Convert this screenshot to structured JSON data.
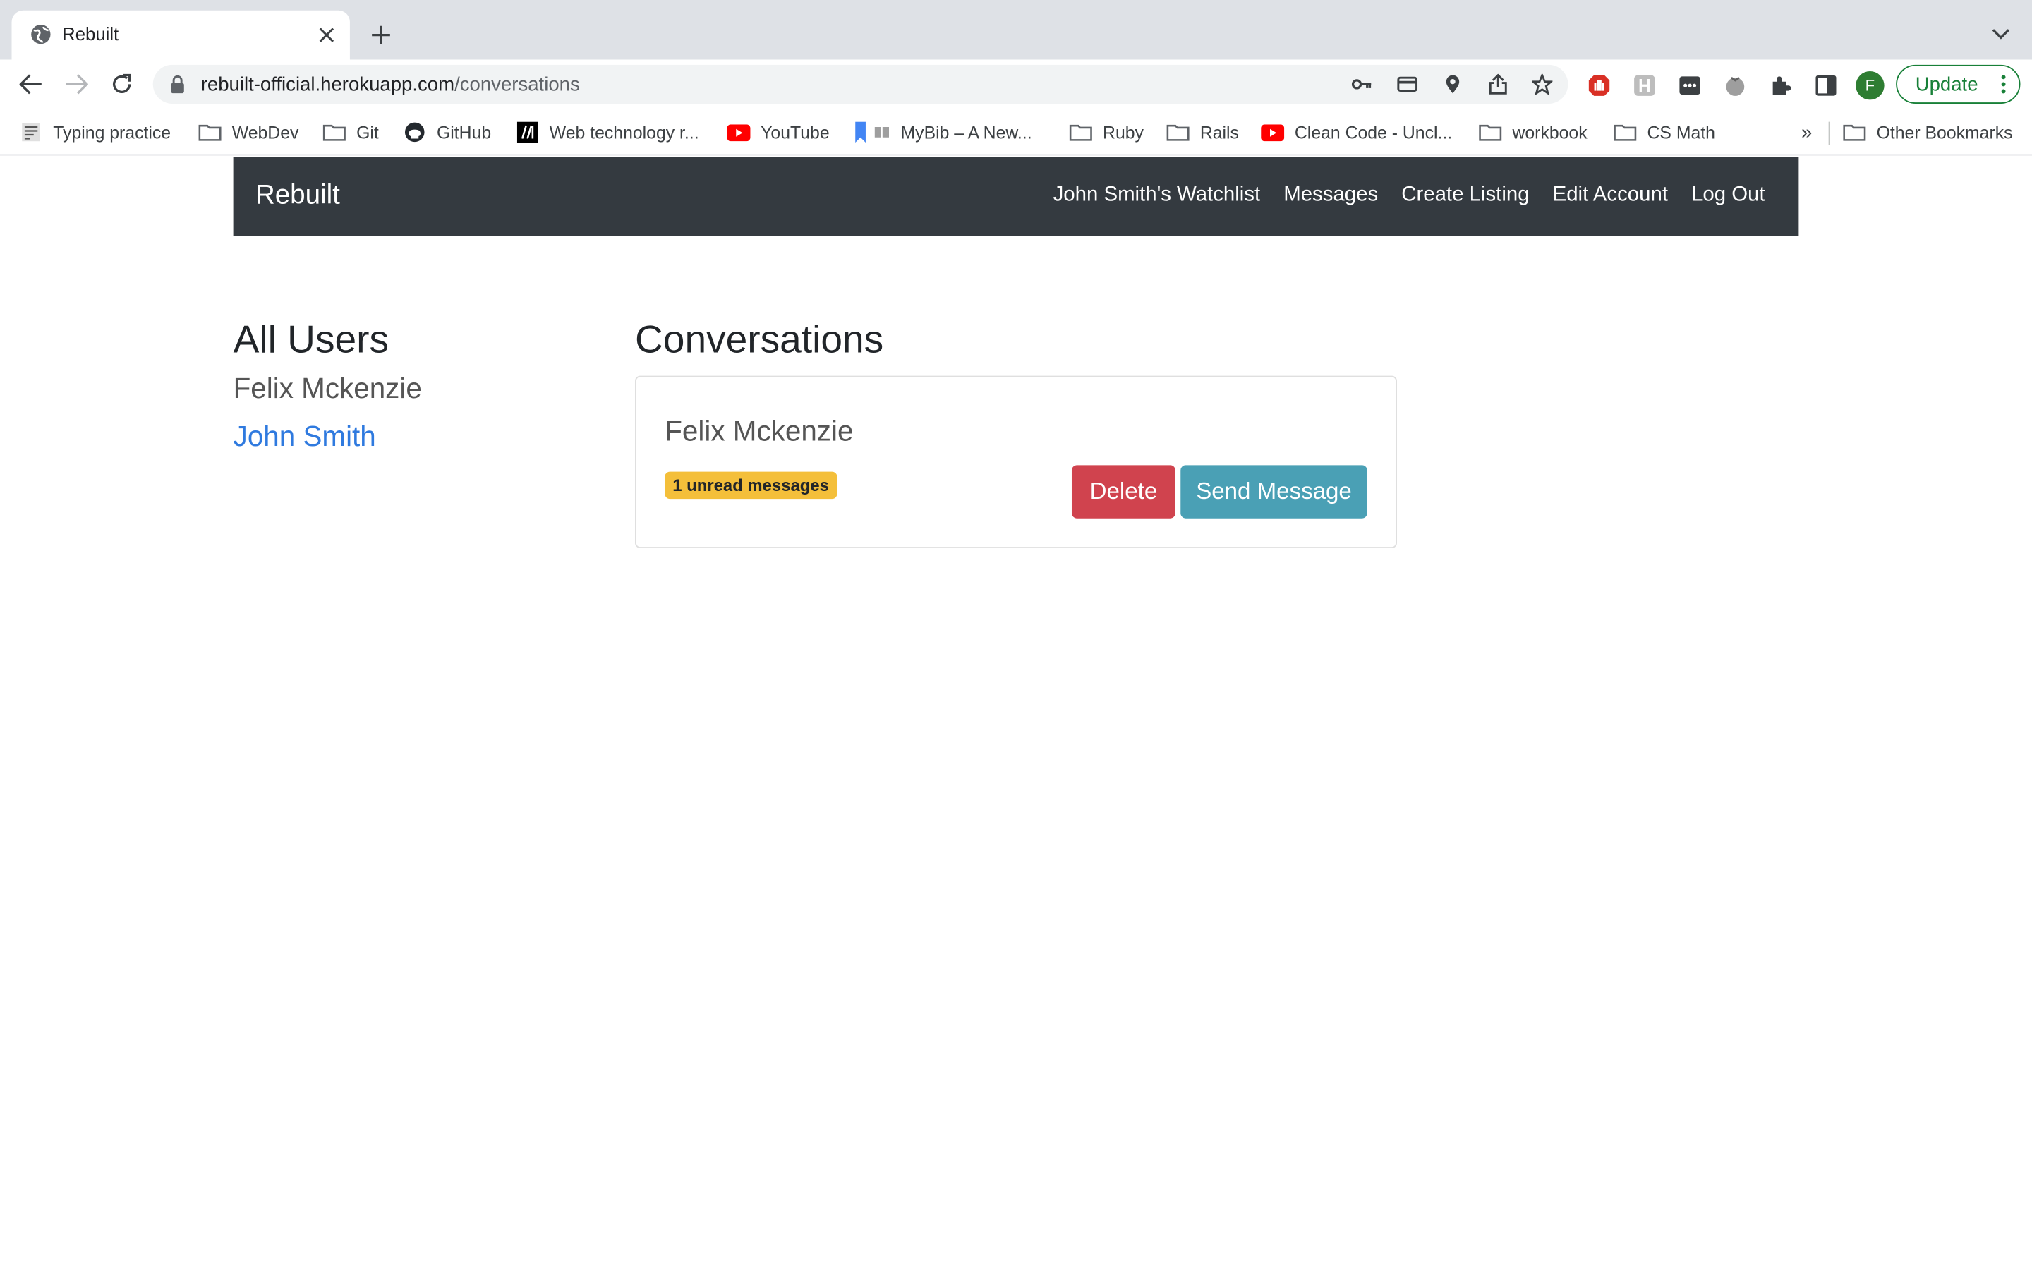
{
  "browser": {
    "tab_title": "Rebuilt",
    "url_host": "rebuilt-official.herokuapp.com",
    "url_path": "/conversations",
    "profile_initial": "F",
    "update_label": "Update",
    "bookmarks": [
      {
        "label": "Typing practice",
        "icon": "typing-icon"
      },
      {
        "label": "WebDev",
        "icon": "folder-icon"
      },
      {
        "label": "Git",
        "icon": "folder-icon"
      },
      {
        "label": "GitHub",
        "icon": "github-icon"
      },
      {
        "label": "Web technology r...",
        "icon": "mdn-icon"
      },
      {
        "label": "YouTube",
        "icon": "youtube-icon"
      },
      {
        "label": "MyBib – A New...",
        "icon": "bookmark-ribbon-icon"
      },
      {
        "label": "Ruby",
        "icon": "folder-icon"
      },
      {
        "label": "Rails",
        "icon": "folder-icon"
      },
      {
        "label": "Clean Code - Uncl...",
        "icon": "youtube-icon"
      },
      {
        "label": "workbook",
        "icon": "folder-icon"
      },
      {
        "label": "CS Math",
        "icon": "folder-icon"
      }
    ],
    "overflow_label": "»",
    "other_bookmarks_label": "Other Bookmarks"
  },
  "navbar": {
    "brand": "Rebuilt",
    "links": [
      "John Smith's Watchlist",
      "Messages",
      "Create Listing",
      "Edit Account",
      "Log Out"
    ]
  },
  "users": {
    "heading": "All Users",
    "items": [
      {
        "name": "Felix Mckenzie",
        "is_link": false
      },
      {
        "name": "John Smith",
        "is_link": true
      }
    ]
  },
  "conversations": {
    "heading": "Conversations",
    "items": [
      {
        "name": "Felix Mckenzie",
        "badge": "1 unread messages",
        "delete_label": "Delete",
        "send_label": "Send Message"
      }
    ]
  },
  "colors": {
    "navbar_bg": "#343a40",
    "link": "#2f7adf",
    "badge": "#f4bf3a",
    "delete": "#d0434e",
    "send": "#4aa0b5"
  }
}
